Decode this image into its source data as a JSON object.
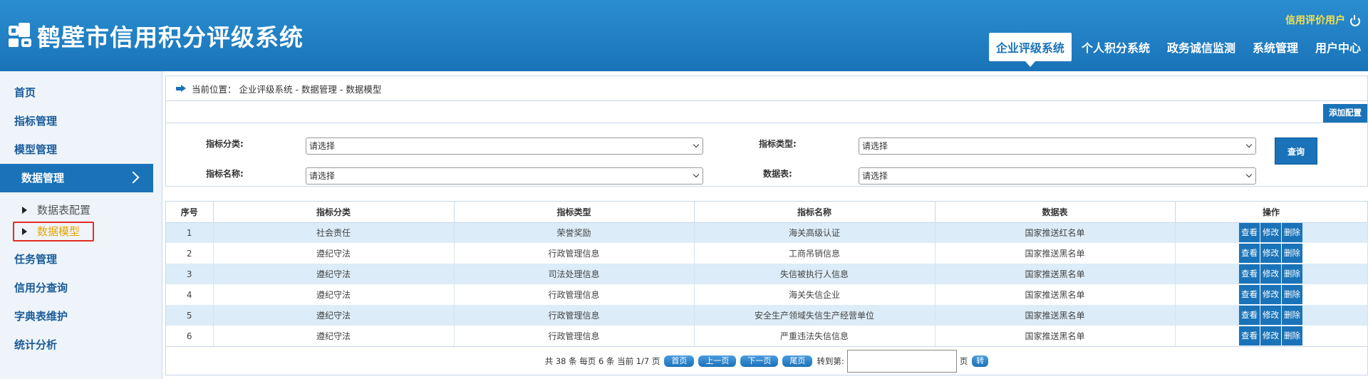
{
  "header": {
    "title": "鹤壁市信用积分评级系统",
    "user": "信用评价用户",
    "nav": [
      {
        "label": "企业评级系统",
        "active": true
      },
      {
        "label": "个人积分系统",
        "active": false
      },
      {
        "label": "政务诚信监测",
        "active": false
      },
      {
        "label": "系统管理",
        "active": false
      },
      {
        "label": "用户中心",
        "active": false
      }
    ]
  },
  "sidebar": {
    "items": [
      {
        "label": "首页"
      },
      {
        "label": "指标管理"
      },
      {
        "label": "模型管理"
      },
      {
        "label": "数据管理"
      },
      {
        "label": "任务管理"
      },
      {
        "label": "信用分查询"
      },
      {
        "label": "字典表维护"
      },
      {
        "label": "统计分析"
      }
    ],
    "sub_items": [
      {
        "label": "数据表配置"
      },
      {
        "label": "数据模型"
      }
    ]
  },
  "breadcrumb": {
    "text": "当前位置：  企业评级系统 - 数据管理 - 数据模型"
  },
  "toolbar": {
    "add_label": "添加配置"
  },
  "filter": {
    "category_label": "指标分类:",
    "category_value": "请选择",
    "type_label": "指标类型:",
    "type_value": "请选择",
    "name_label": "指标名称:",
    "name_value": "请选择",
    "table_label": "数据表:",
    "table_value": "请选择",
    "query_label": "查询"
  },
  "table": {
    "headers": [
      "序号",
      "指标分类",
      "指标类型",
      "指标名称",
      "数据表",
      "操作"
    ],
    "rows": [
      [
        "1",
        "社会责任",
        "荣誉奖励",
        "海关高级认证",
        "国家推送红名单"
      ],
      [
        "2",
        "遵纪守法",
        "行政管理信息",
        "工商吊销信息",
        "国家推送黑名单"
      ],
      [
        "3",
        "遵纪守法",
        "司法处理信息",
        "失信被执行人信息",
        "国家推送黑名单"
      ],
      [
        "4",
        "遵纪守法",
        "行政管理信息",
        "海关失信企业",
        "国家推送黑名单"
      ],
      [
        "5",
        "遵纪守法",
        "行政管理信息",
        "安全生产领域失信生产经营单位",
        "国家推送黑名单"
      ],
      [
        "6",
        "遵纪守法",
        "行政管理信息",
        "严重违法失信信息",
        "国家推送黑名单"
      ]
    ],
    "actions": [
      "查看",
      "修改",
      "删除"
    ]
  },
  "pager": {
    "summary": "共 38 条 每页 6 条 当前 1/7 页",
    "first": "首页",
    "prev": "上一页",
    "next": "下一页",
    "last": "尾页",
    "goto_label": "转到第:",
    "page_unit": "页",
    "go": "转"
  }
}
